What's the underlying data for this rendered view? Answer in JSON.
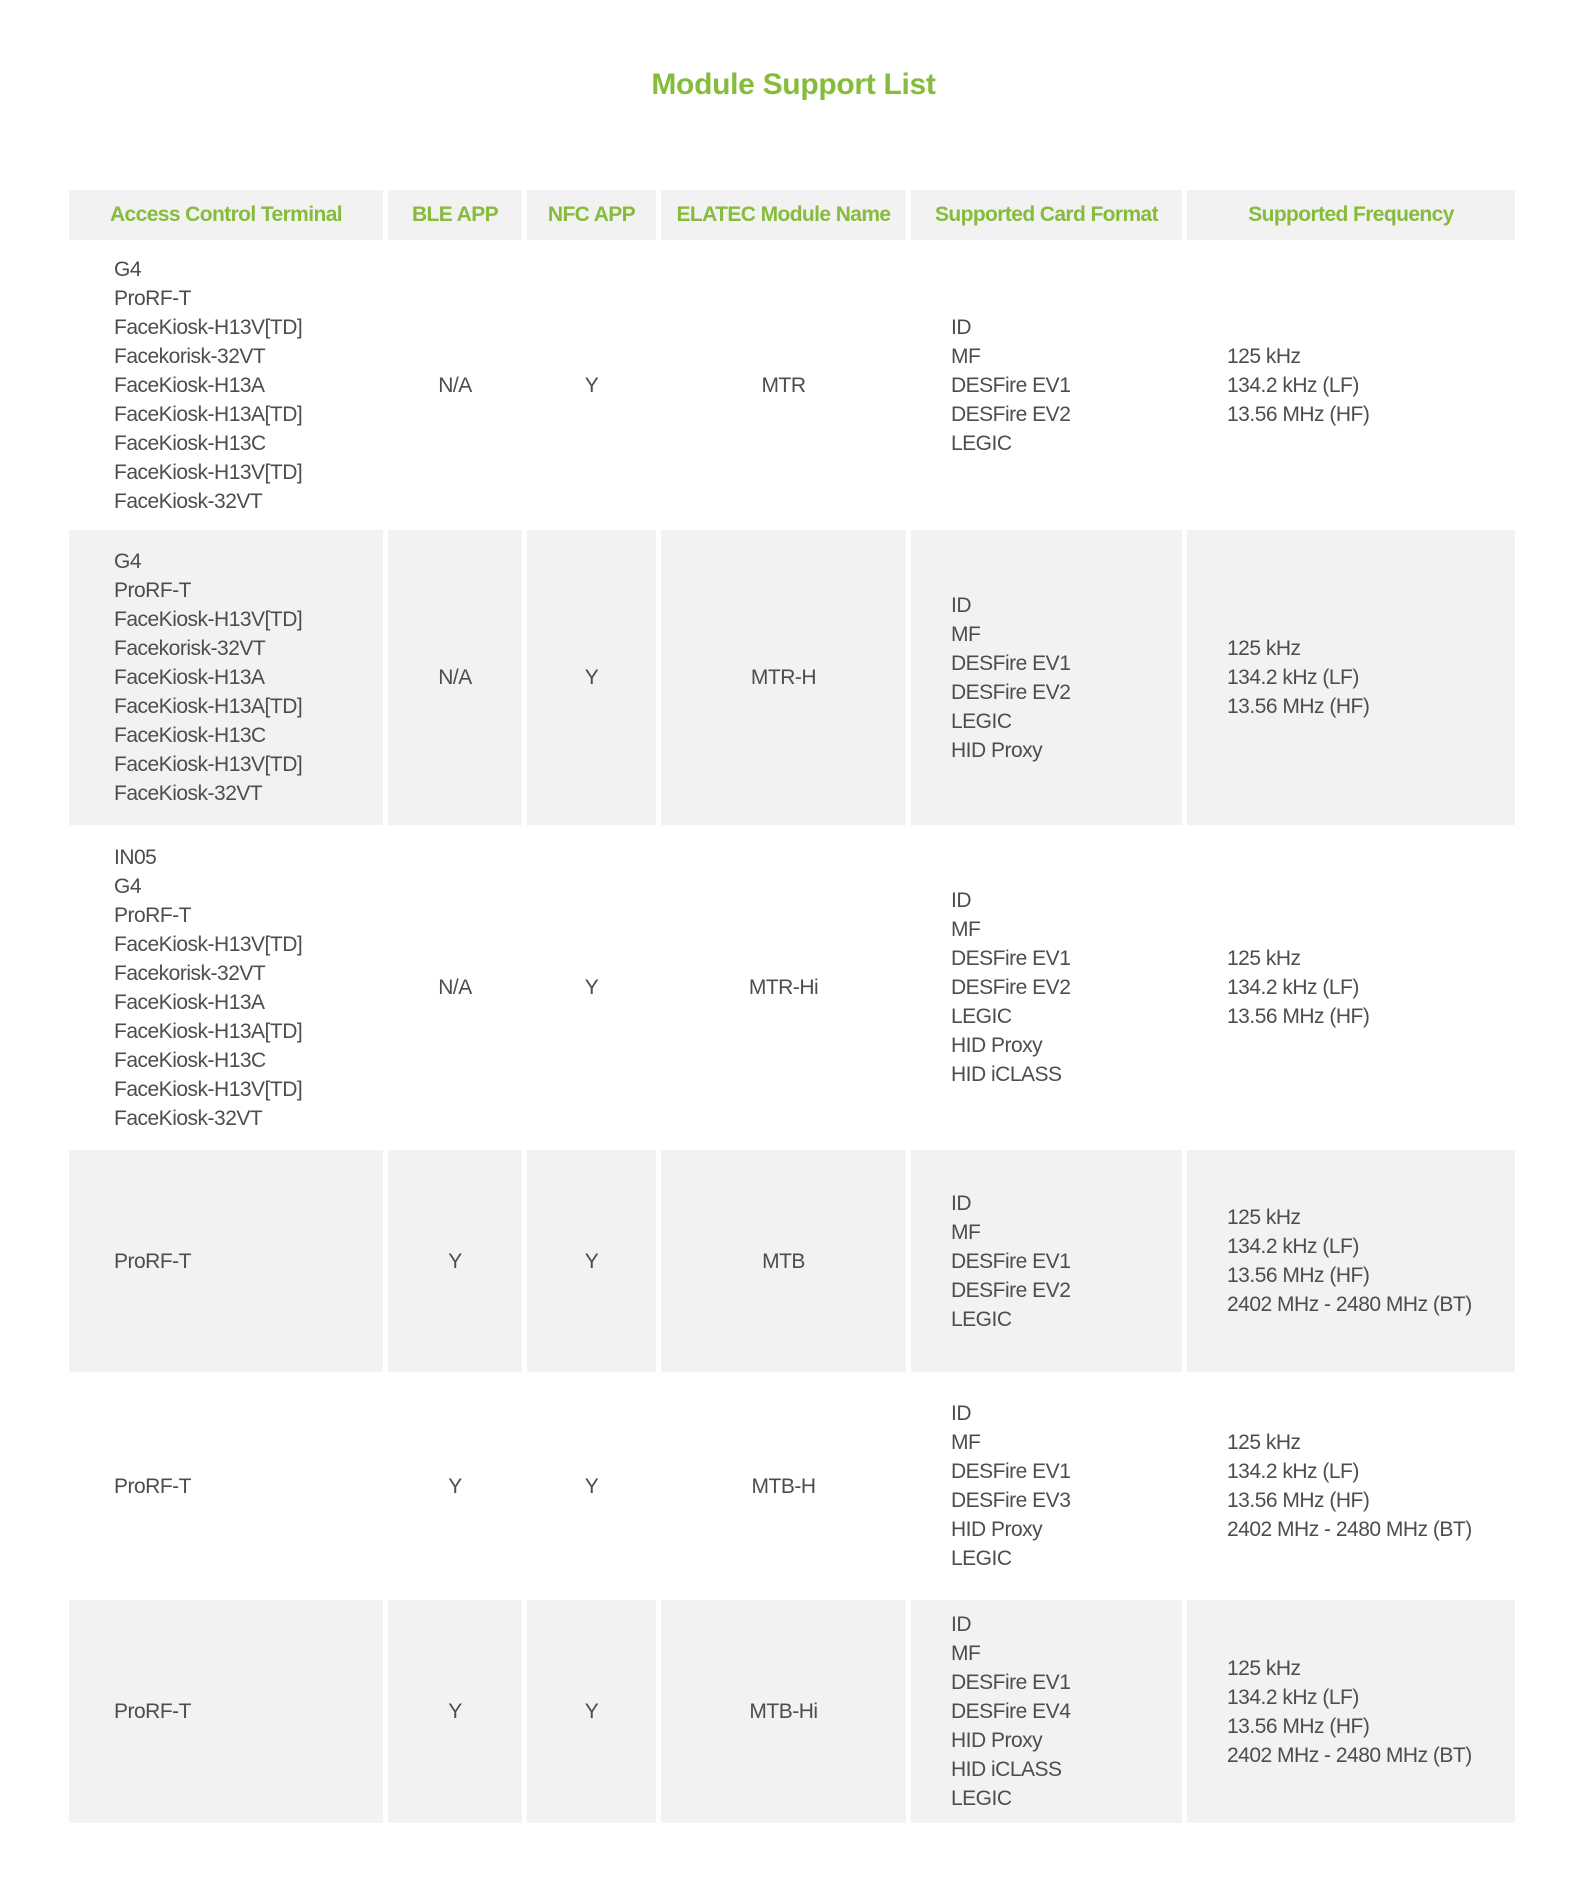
{
  "page": {
    "title": "Module Support List",
    "accent_color": "#86bc3c",
    "row_stripe_color": "#f2f2f2"
  },
  "table": {
    "headers": [
      "Access Control Terminal",
      "BLE APP",
      "NFC APP",
      "ELATEC Module Name",
      "Supported Card Format",
      "Supported Frequency"
    ],
    "rows": [
      {
        "terminals": [
          "G4",
          "ProRF-T",
          "FaceKiosk-H13V[TD]",
          "Facekorisk-32VT",
          "FaceKiosk-H13A",
          "FaceKiosk-H13A[TD]",
          "FaceKiosk-H13C",
          "FaceKiosk-H13V[TD]",
          "FaceKiosk-32VT"
        ],
        "ble_app": "N/A",
        "nfc_app": "Y",
        "module": "MTR",
        "card_formats": [
          "ID",
          "MF",
          "DESFire EV1",
          "DESFire EV2",
          "LEGIC"
        ],
        "frequencies": [
          "125 kHz",
          "134.2 kHz (LF)",
          "13.56 MHz (HF)"
        ]
      },
      {
        "terminals": [
          "G4",
          "ProRF-T",
          "FaceKiosk-H13V[TD]",
          "Facekorisk-32VT",
          "FaceKiosk-H13A",
          "FaceKiosk-H13A[TD]",
          "FaceKiosk-H13C",
          "FaceKiosk-H13V[TD]",
          "FaceKiosk-32VT"
        ],
        "ble_app": "N/A",
        "nfc_app": "Y",
        "module": "MTR-H",
        "card_formats": [
          "ID",
          "MF",
          "DESFire EV1",
          "DESFire EV2",
          "LEGIC",
          "HID Proxy"
        ],
        "frequencies": [
          "125 kHz",
          "134.2 kHz (LF)",
          "13.56 MHz (HF)"
        ]
      },
      {
        "terminals": [
          "IN05",
          "G4",
          "ProRF-T",
          "FaceKiosk-H13V[TD]",
          "Facekorisk-32VT",
          "FaceKiosk-H13A",
          "FaceKiosk-H13A[TD]",
          "FaceKiosk-H13C",
          "FaceKiosk-H13V[TD]",
          "FaceKiosk-32VT"
        ],
        "ble_app": "N/A",
        "nfc_app": "Y",
        "module": "MTR-Hi",
        "card_formats": [
          "ID",
          "MF",
          "DESFire EV1",
          "DESFire EV2",
          "LEGIC",
          "HID Proxy",
          "HID iCLASS"
        ],
        "frequencies": [
          "125 kHz",
          "134.2 kHz (LF)",
          "13.56 MHz (HF)"
        ]
      },
      {
        "terminals": [
          "ProRF-T"
        ],
        "ble_app": "Y",
        "nfc_app": "Y",
        "module": "MTB",
        "card_formats": [
          "ID",
          "MF",
          "DESFire EV1",
          "DESFire EV2",
          "LEGIC"
        ],
        "frequencies": [
          "125 kHz",
          "134.2 kHz (LF)",
          "13.56 MHz (HF)",
          "2402 MHz - 2480 MHz (BT)"
        ]
      },
      {
        "terminals": [
          "ProRF-T"
        ],
        "ble_app": "Y",
        "nfc_app": "Y",
        "module": "MTB-H",
        "card_formats": [
          "ID",
          "MF",
          "DESFire EV1",
          "DESFire EV3",
          "HID Proxy",
          "LEGIC"
        ],
        "frequencies": [
          "125 kHz",
          "134.2 kHz (LF)",
          "13.56 MHz (HF)",
          "2402 MHz - 2480 MHz (BT)"
        ]
      },
      {
        "terminals": [
          "ProRF-T"
        ],
        "ble_app": "Y",
        "nfc_app": "Y",
        "module": "MTB-Hi",
        "card_formats": [
          "ID",
          "MF",
          "DESFire EV1",
          "DESFire EV4",
          "HID Proxy",
          "HID iCLASS",
          "LEGIC"
        ],
        "frequencies": [
          "125 kHz",
          "134.2 kHz (LF)",
          "13.56 MHz (HF)",
          "2402 MHz - 2480 MHz (BT)"
        ]
      }
    ]
  }
}
